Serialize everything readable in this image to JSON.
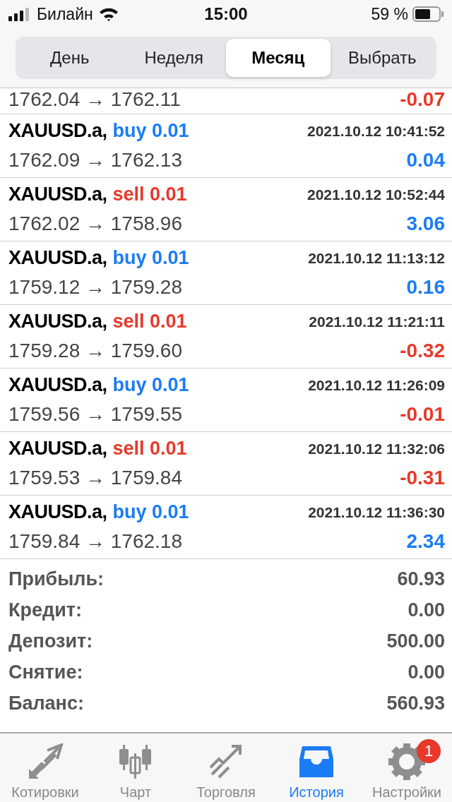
{
  "status_bar": {
    "carrier": "Билайн",
    "time": "15:00",
    "battery": "59 %"
  },
  "periods": [
    {
      "label": "День",
      "selected": false
    },
    {
      "label": "Неделя",
      "selected": false
    },
    {
      "label": "Месяц",
      "selected": true
    },
    {
      "label": "Выбрать",
      "selected": false
    }
  ],
  "trades": [
    {
      "prices": "1762.04 → 1762.11",
      "profit": "-0.07",
      "loss": true
    },
    {
      "symbol": "XAUUSD.a,",
      "sell": false,
      "order": "buy 0.01",
      "time": "2021.10.12 10:41:52",
      "prices": "1762.09 → 1762.13",
      "profit": "0.04",
      "loss": false
    },
    {
      "symbol": "XAUUSD.a,",
      "sell": true,
      "order": "sell 0.01",
      "time": "2021.10.12 10:52:44",
      "prices": "1762.02 → 1758.96",
      "profit": "3.06",
      "loss": false
    },
    {
      "symbol": "XAUUSD.a,",
      "sell": false,
      "order": "buy 0.01",
      "time": "2021.10.12 11:13:12",
      "prices": "1759.12 → 1759.28",
      "profit": "0.16",
      "loss": false
    },
    {
      "symbol": "XAUUSD.a,",
      "sell": true,
      "order": "sell 0.01",
      "time": "2021.10.12 11:21:11",
      "prices": "1759.28 → 1759.60",
      "profit": "-0.32",
      "loss": true
    },
    {
      "symbol": "XAUUSD.a,",
      "sell": false,
      "order": "buy 0.01",
      "time": "2021.10.12 11:26:09",
      "prices": "1759.56 → 1759.55",
      "profit": "-0.01",
      "loss": true
    },
    {
      "symbol": "XAUUSD.a,",
      "sell": true,
      "order": "sell 0.01",
      "time": "2021.10.12 11:32:06",
      "prices": "1759.53 → 1759.84",
      "profit": "-0.31",
      "loss": true
    },
    {
      "symbol": "XAUUSD.a,",
      "sell": false,
      "order": "buy 0.01",
      "time": "2021.10.12 11:36:30",
      "prices": "1759.84 → 1762.18",
      "profit": "2.34",
      "loss": false
    }
  ],
  "summary": [
    {
      "label": "Прибыль:",
      "value": "60.93"
    },
    {
      "label": "Кредит:",
      "value": "0.00"
    },
    {
      "label": "Депозит:",
      "value": "500.00"
    },
    {
      "label": "Снятие:",
      "value": "0.00"
    },
    {
      "label": "Баланс:",
      "value": "560.93"
    }
  ],
  "tab_bar": [
    {
      "kind": "quotes",
      "label": "Котировки",
      "selected": false
    },
    {
      "kind": "chart",
      "label": "Чарт",
      "selected": false
    },
    {
      "kind": "trade",
      "label": "Торговля",
      "selected": false
    },
    {
      "kind": "history",
      "label": "История",
      "selected": true
    },
    {
      "kind": "settings",
      "label": "Настройки",
      "selected": false,
      "badge": "1"
    }
  ]
}
